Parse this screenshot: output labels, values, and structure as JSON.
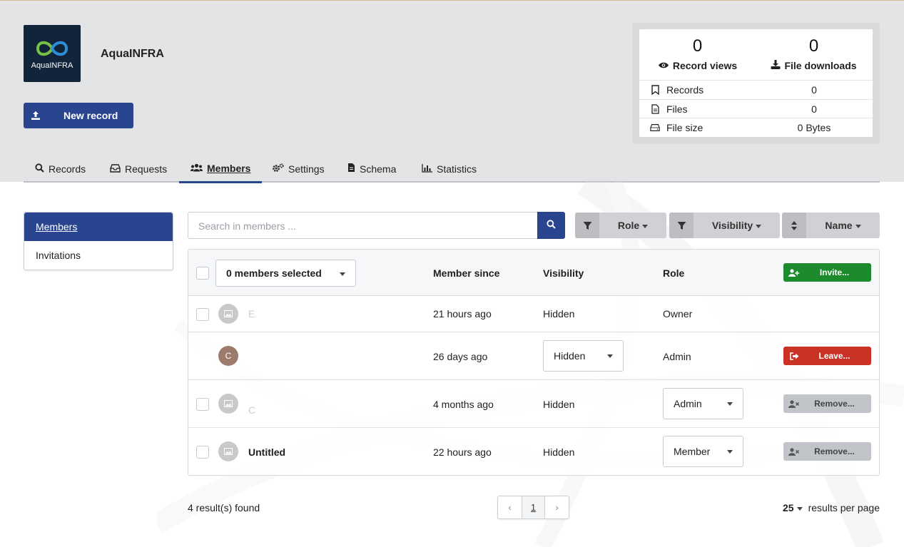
{
  "community": {
    "logo_text": "AquaINFRA",
    "title": "AquaINFRA",
    "new_record_label": "New record"
  },
  "stats": {
    "record_views": "0",
    "record_views_label": "Record views",
    "file_downloads": "0",
    "file_downloads_label": "File downloads",
    "rows": [
      {
        "label": "Records",
        "value": "0",
        "icon": "bookmark-icon"
      },
      {
        "label": "Files",
        "value": "0",
        "icon": "file-icon"
      },
      {
        "label": "File size",
        "value": "0 Bytes",
        "icon": "hdd-icon"
      }
    ]
  },
  "tabs": [
    {
      "label": "Records",
      "icon": "search-icon"
    },
    {
      "label": "Requests",
      "icon": "inbox-icon"
    },
    {
      "label": "Members",
      "icon": "users-icon",
      "active": true
    },
    {
      "label": "Settings",
      "icon": "cogs-icon"
    },
    {
      "label": "Schema",
      "icon": "file-icon"
    },
    {
      "label": "Statistics",
      "icon": "bar-chart-icon"
    }
  ],
  "sidenav": {
    "items": [
      {
        "label": "Members",
        "active": true
      },
      {
        "label": "Invitations"
      }
    ]
  },
  "search": {
    "placeholder": "Search in members ..."
  },
  "filters": {
    "role": "Role",
    "visibility": "Visibility",
    "sort": "Name"
  },
  "table": {
    "selected_label": "0 members selected",
    "headers": {
      "member_since": "Member since",
      "visibility": "Visibility",
      "role": "Role"
    },
    "invite_label": "Invite...",
    "rows": [
      {
        "name": "E",
        "since": "21 hours ago",
        "visibility": "Hidden",
        "role": "Owner"
      },
      {
        "avatar_letter": "C",
        "since": "26 days ago",
        "visibility": "Hidden",
        "role": "Admin",
        "action": "Leave..."
      },
      {
        "name": "C",
        "since": "4 months ago",
        "visibility": "Hidden",
        "role": "Admin",
        "action": "Remove..."
      },
      {
        "name": "Untitled",
        "since": "22 hours ago",
        "visibility": "Hidden",
        "role": "Member",
        "action": "Remove..."
      }
    ]
  },
  "footer": {
    "results": "4 result(s) found",
    "page_prev": "‹",
    "page_current": "1",
    "page_next": "›",
    "per_page_value": "25",
    "per_page_label": "results per page"
  },
  "colors": {
    "primary": "#2a4590",
    "success": "#1e8a2e",
    "danger": "#c93224",
    "header_bg": "#e3e4e6"
  }
}
